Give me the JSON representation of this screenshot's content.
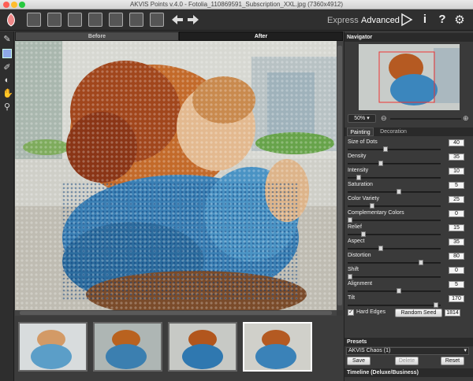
{
  "window": {
    "title": "AKVIS Points v.4.0 - Fotolia_110869591_Subscription_XXL.jpg (7360x4912)"
  },
  "toolbar": {
    "icons": [
      "app-logo-icon",
      "open-file-icon",
      "save-file-icon",
      "print-icon",
      "share-icon",
      "batch-icon",
      "plugin-icon",
      "preferences-icon",
      "undo-icon",
      "redo-icon",
      "run-icon",
      "info-icon",
      "help-icon",
      "settings-icon"
    ],
    "mode_express": "Express",
    "mode_advanced": "Advanced"
  },
  "left_tools": [
    "brush-icon",
    "history-brush-icon",
    "eraser-icon",
    "smudge-icon",
    "hand-icon",
    "zoom-icon"
  ],
  "view_tabs": {
    "before": "Before",
    "after": "After"
  },
  "navigator": {
    "title": "Navigator",
    "zoom": "50%"
  },
  "settings_tabs": {
    "painting": "Painting",
    "decoration": "Decoration"
  },
  "params": [
    {
      "label": "Size of Dots",
      "value": "40",
      "fraction": 0.4
    },
    {
      "label": "Density",
      "value": "35",
      "fraction": 0.35
    },
    {
      "label": "Intensity",
      "value": "10",
      "fraction": 0.1
    },
    {
      "label": "Saturation",
      "value": "5",
      "fraction": 0.55
    },
    {
      "label": "Color Variety",
      "value": "25",
      "fraction": 0.25
    },
    {
      "label": "Complementary Colors",
      "value": "0",
      "fraction": 0.0
    },
    {
      "label": "Relief",
      "value": "15",
      "fraction": 0.15
    },
    {
      "label": "Aspect",
      "value": "35",
      "fraction": 0.35
    },
    {
      "label": "Distortion",
      "value": "80",
      "fraction": 0.8
    },
    {
      "label": "Shift",
      "value": "0",
      "fraction": 0.0
    },
    {
      "label": "Alignment",
      "value": "5",
      "fraction": 0.55
    },
    {
      "label": "Tilt",
      "value": "170",
      "fraction": 0.97
    }
  ],
  "hard_edges": {
    "label": "Hard Edges",
    "checked": true
  },
  "random_seed": {
    "button": "Random Seed",
    "value": "1814"
  },
  "presets": {
    "title": "Presets",
    "selected": "AKVIS Chaos (1)",
    "save": "Save",
    "delete": "Delete",
    "reset": "Reset"
  },
  "timeline": {
    "title": "Timeline (Deluxe/Business)"
  }
}
